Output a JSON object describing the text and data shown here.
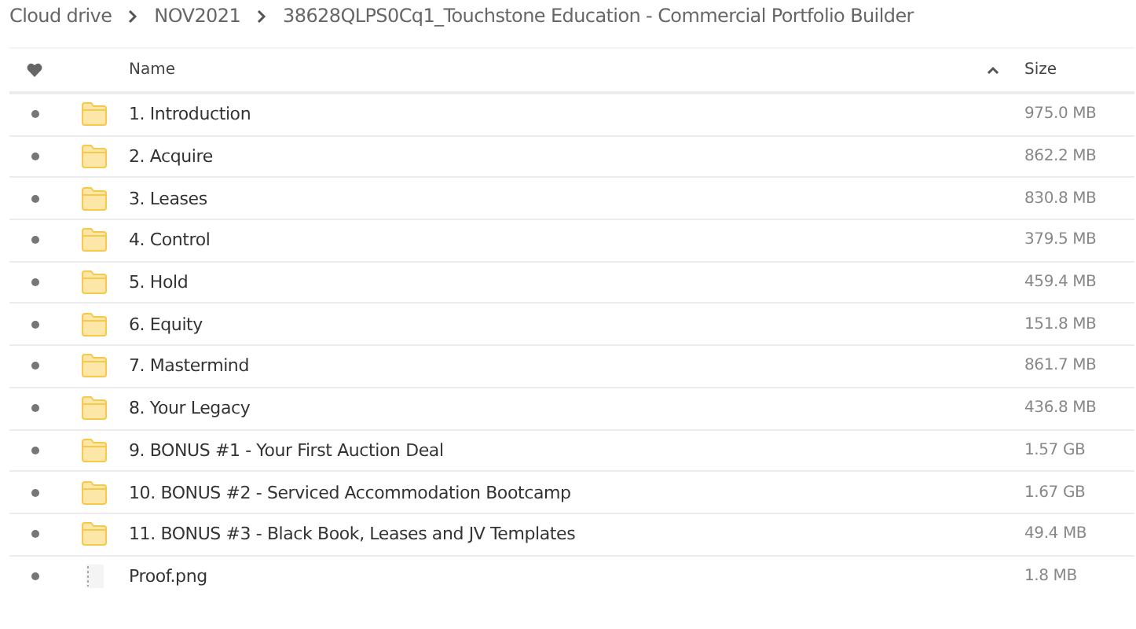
{
  "breadcrumb": [
    "Cloud drive",
    "NOV2021",
    "38628QLPS0Cq1_Touchstone Education - Commercial Portfolio Builder"
  ],
  "table": {
    "columns": [
      "Name",
      "Size"
    ],
    "sorted_ascending": true,
    "rows": [
      {
        "kind": "folder",
        "name": "1. Introduction",
        "size": "975.0 MB"
      },
      {
        "kind": "folder",
        "name": "2. Acquire",
        "size": "862.2 MB"
      },
      {
        "kind": "folder",
        "name": "3. Leases",
        "size": "830.8 MB"
      },
      {
        "kind": "folder",
        "name": "4. Control",
        "size": "379.5 MB"
      },
      {
        "kind": "folder",
        "name": "5. Hold",
        "size": "459.4 MB"
      },
      {
        "kind": "folder",
        "name": "6. Equity",
        "size": "151.8 MB"
      },
      {
        "kind": "folder",
        "name": "7. Mastermind",
        "size": "861.7 MB"
      },
      {
        "kind": "folder",
        "name": "8. Your Legacy",
        "size": "436.8 MB"
      },
      {
        "kind": "folder",
        "name": "9. BONUS #1 - Your First Auction Deal",
        "size": "1.57 GB"
      },
      {
        "kind": "folder",
        "name": "10. BONUS #2 - Serviced Accommodation Bootcamp",
        "size": "1.67 GB"
      },
      {
        "kind": "folder",
        "name": "11. BONUS #3 - Black Book, Leases and JV Templates",
        "size": "49.4 MB"
      },
      {
        "kind": "file",
        "name": "Proof.png",
        "size": "1.8 MB"
      }
    ]
  }
}
